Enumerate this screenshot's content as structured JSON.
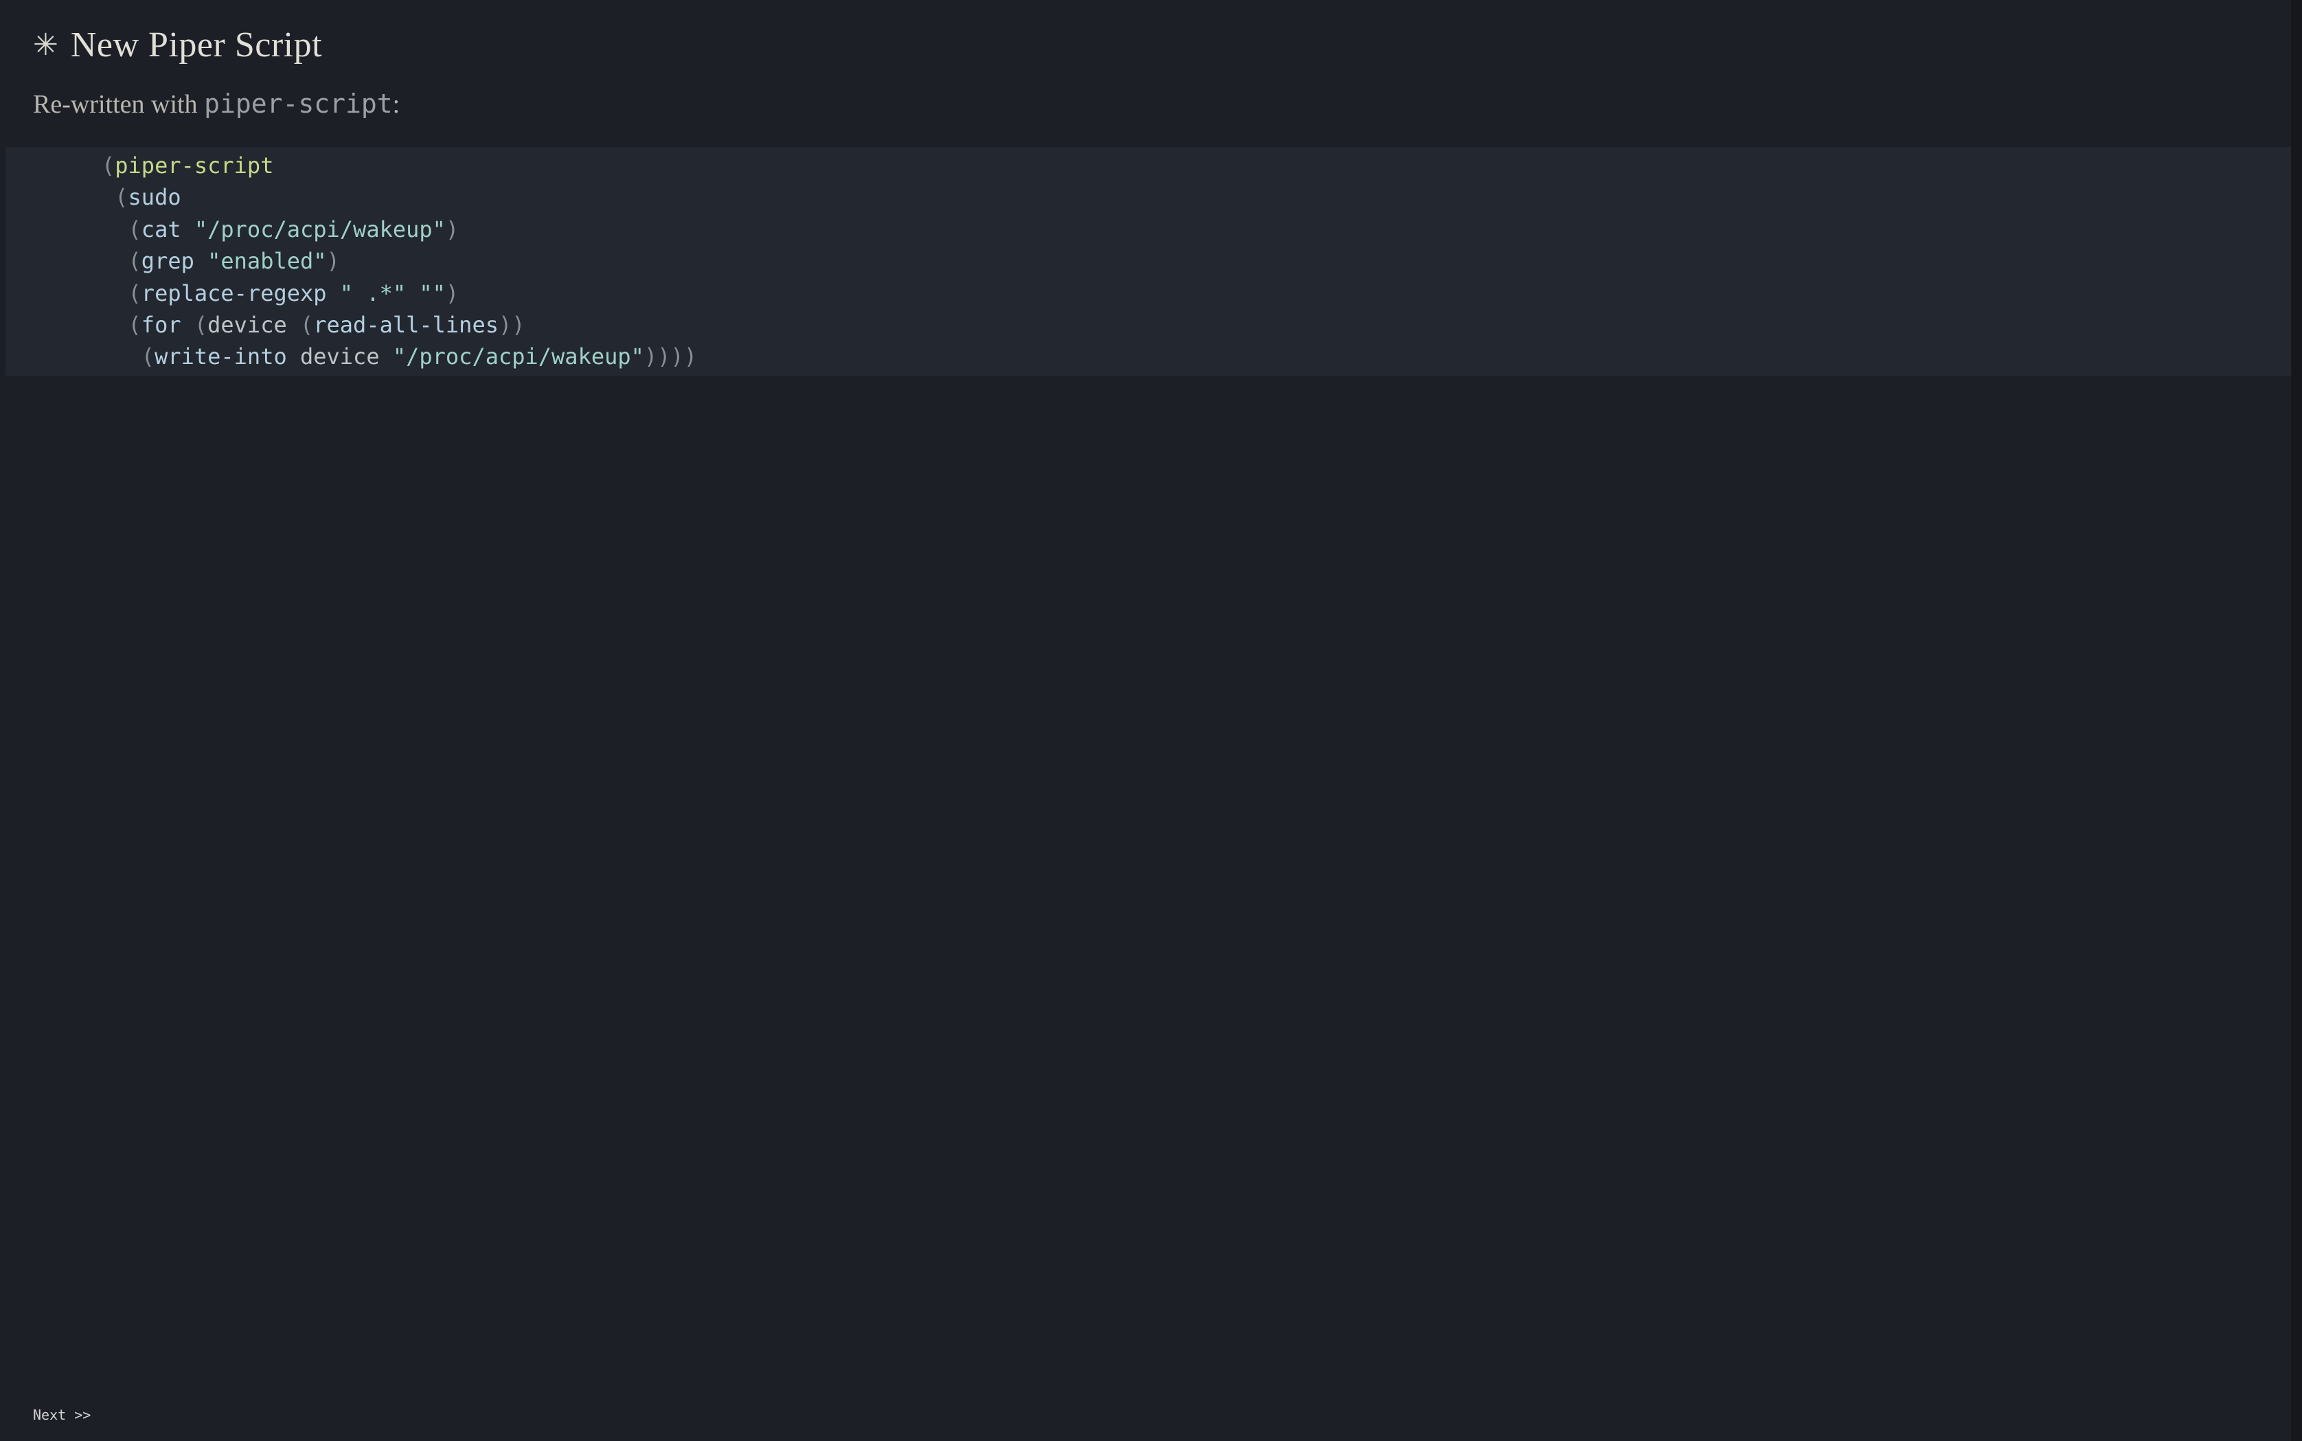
{
  "heading": {
    "icon": "✳",
    "title": "New Piper Script"
  },
  "intro": {
    "prefix": "Re-written with ",
    "code": "piper-script",
    "suffix": ":"
  },
  "code": {
    "lines": [
      [
        {
          "cls": "tok-paren",
          "t": "("
        },
        {
          "cls": "tok-fn",
          "t": "piper-script"
        }
      ],
      [
        {
          "cls": "tok-plain",
          "t": " "
        },
        {
          "cls": "tok-paren",
          "t": "("
        },
        {
          "cls": "tok-kw",
          "t": "sudo"
        }
      ],
      [
        {
          "cls": "tok-plain",
          "t": "  "
        },
        {
          "cls": "tok-paren",
          "t": "("
        },
        {
          "cls": "tok-kw",
          "t": "cat"
        },
        {
          "cls": "tok-plain",
          "t": " "
        },
        {
          "cls": "tok-str",
          "t": "\"/proc/acpi/wakeup\""
        },
        {
          "cls": "tok-paren",
          "t": ")"
        }
      ],
      [
        {
          "cls": "tok-plain",
          "t": "  "
        },
        {
          "cls": "tok-paren",
          "t": "("
        },
        {
          "cls": "tok-kw",
          "t": "grep"
        },
        {
          "cls": "tok-plain",
          "t": " "
        },
        {
          "cls": "tok-str",
          "t": "\"enabled\""
        },
        {
          "cls": "tok-paren",
          "t": ")"
        }
      ],
      [
        {
          "cls": "tok-plain",
          "t": "  "
        },
        {
          "cls": "tok-paren",
          "t": "("
        },
        {
          "cls": "tok-kw",
          "t": "replace-regexp"
        },
        {
          "cls": "tok-plain",
          "t": " "
        },
        {
          "cls": "tok-str",
          "t": "\" .*\""
        },
        {
          "cls": "tok-plain",
          "t": " "
        },
        {
          "cls": "tok-str",
          "t": "\"\""
        },
        {
          "cls": "tok-paren",
          "t": ")"
        }
      ],
      [
        {
          "cls": "tok-plain",
          "t": "  "
        },
        {
          "cls": "tok-paren",
          "t": "("
        },
        {
          "cls": "tok-kw",
          "t": "for"
        },
        {
          "cls": "tok-plain",
          "t": " "
        },
        {
          "cls": "tok-paren",
          "t": "("
        },
        {
          "cls": "tok-plain",
          "t": "device "
        },
        {
          "cls": "tok-paren",
          "t": "("
        },
        {
          "cls": "tok-kw",
          "t": "read-all-lines"
        },
        {
          "cls": "tok-paren",
          "t": "))"
        }
      ],
      [
        {
          "cls": "tok-plain",
          "t": "   "
        },
        {
          "cls": "tok-paren",
          "t": "("
        },
        {
          "cls": "tok-kw",
          "t": "write-into"
        },
        {
          "cls": "tok-plain",
          "t": " device "
        },
        {
          "cls": "tok-str",
          "t": "\"/proc/acpi/wakeup\""
        },
        {
          "cls": "tok-paren",
          "t": "))))"
        }
      ]
    ]
  },
  "nav": {
    "next_label": "Next >>"
  }
}
